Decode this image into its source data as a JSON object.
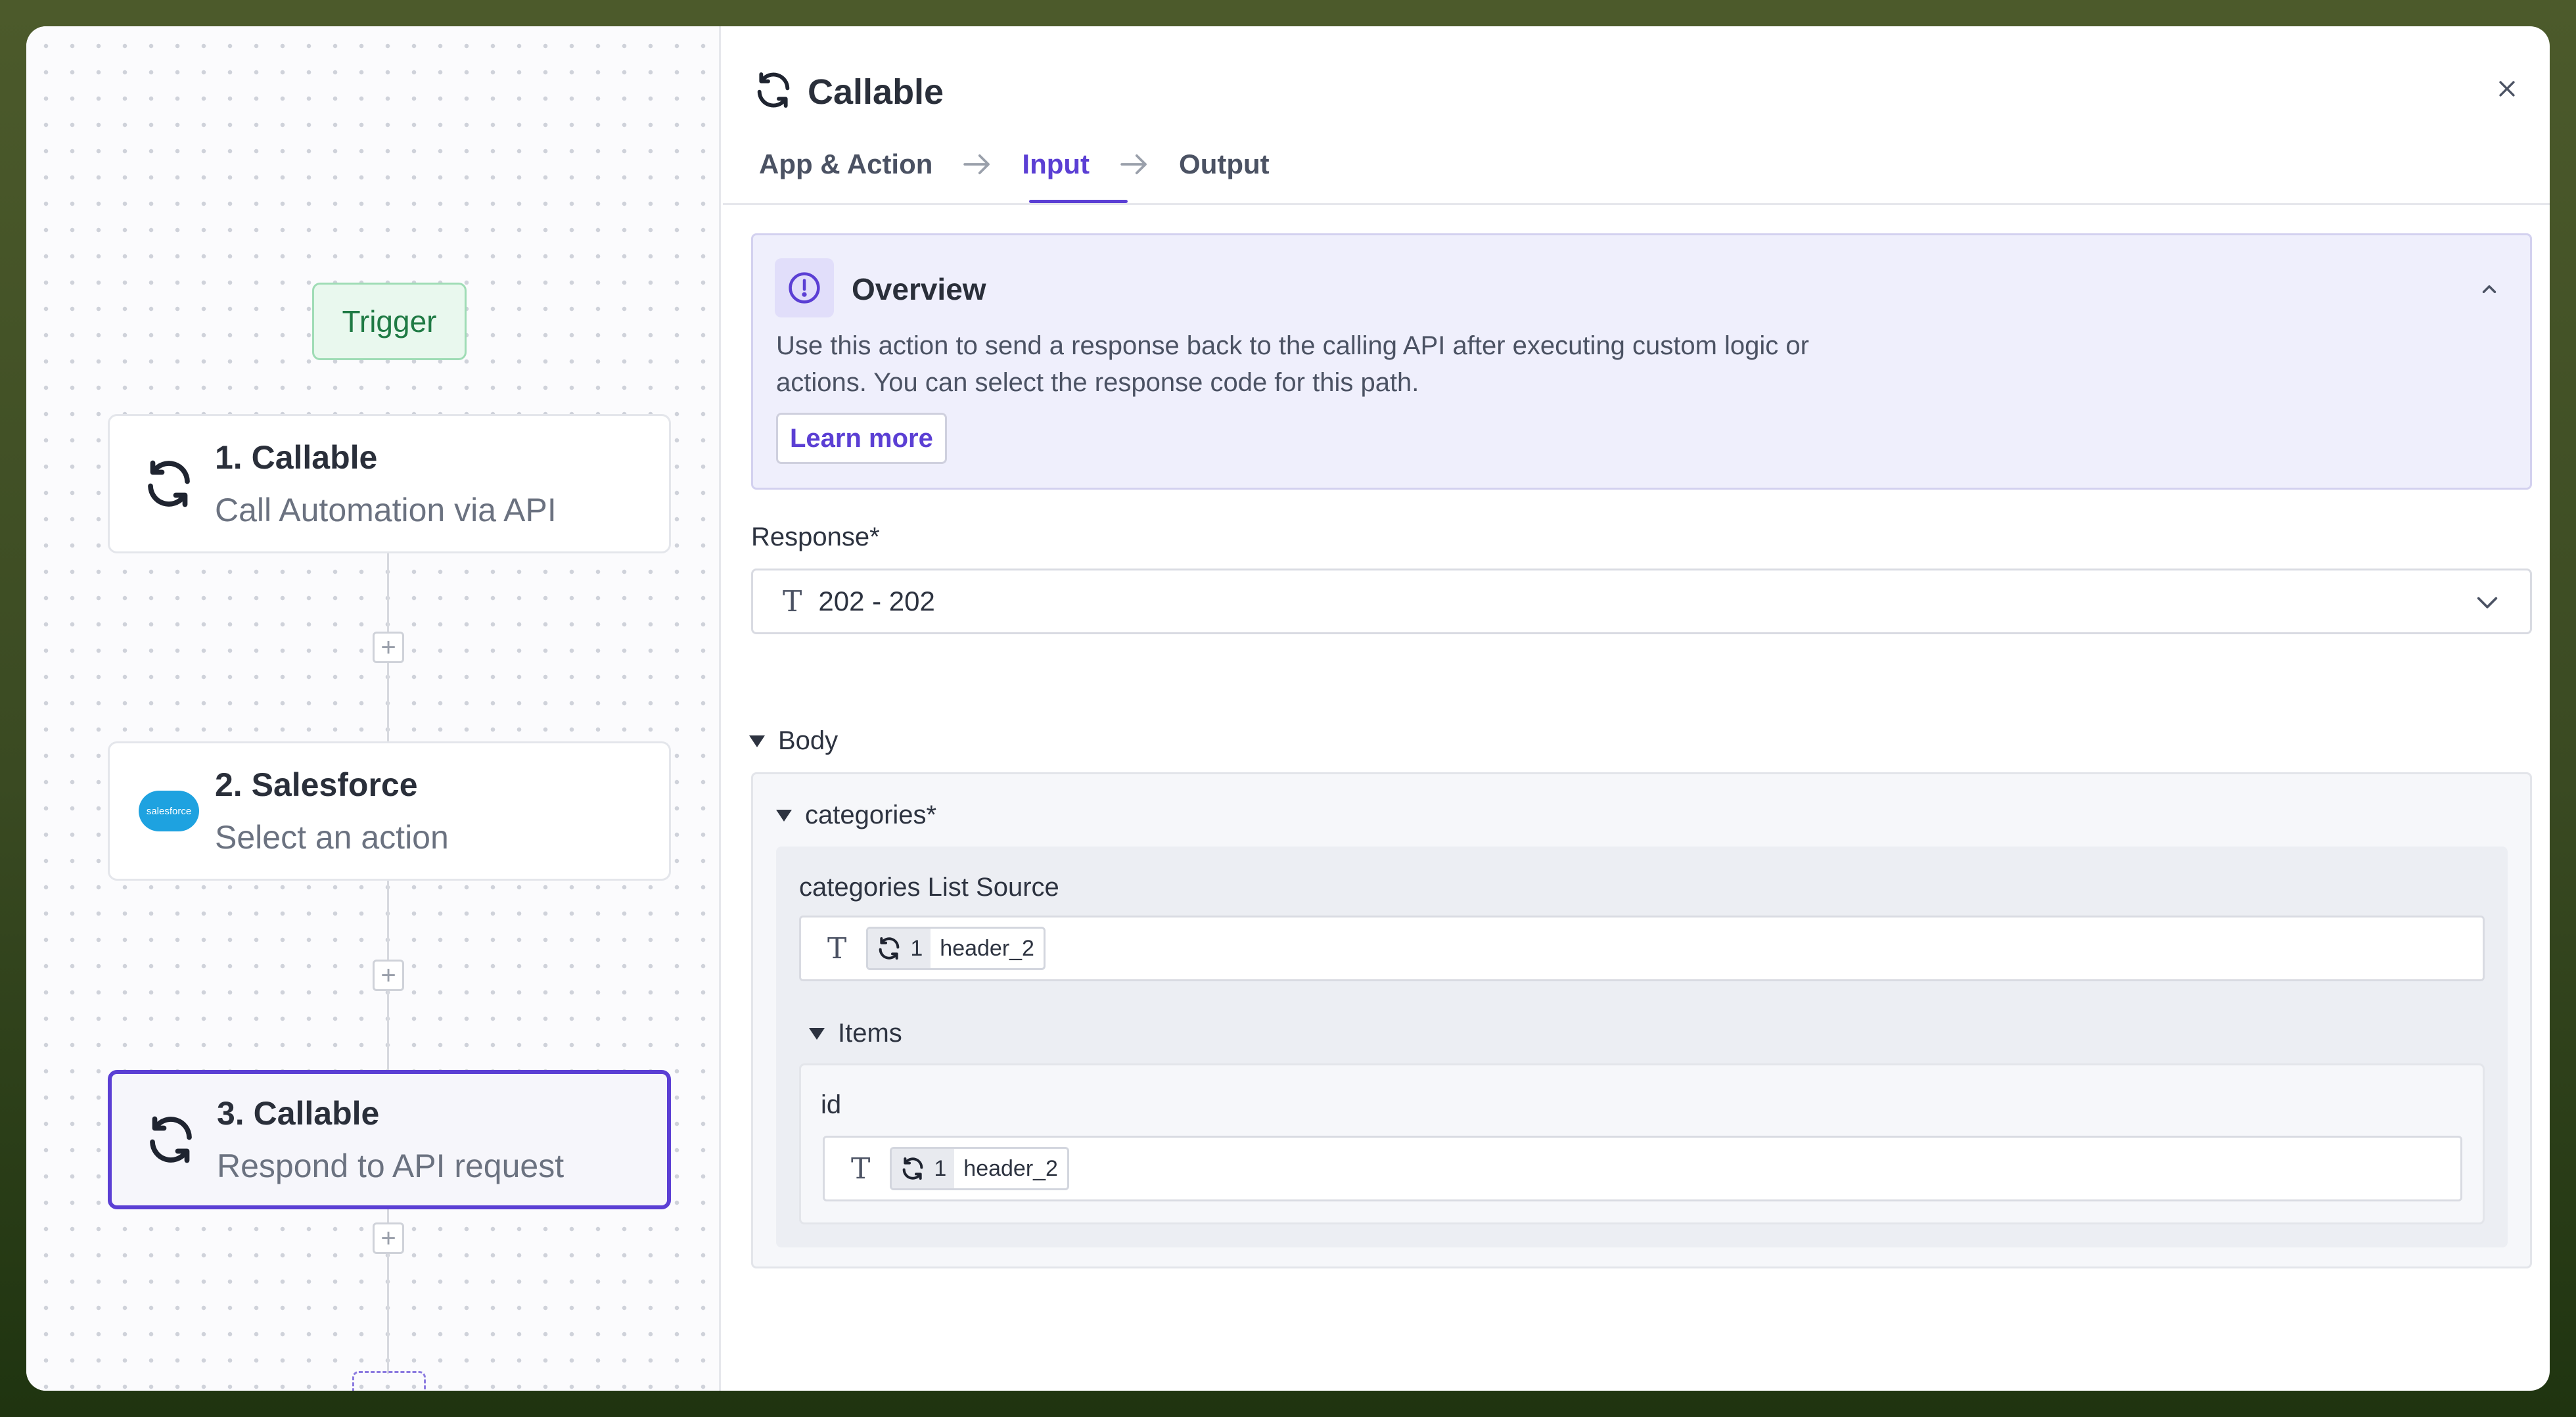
{
  "canvas": {
    "trigger_label": "Trigger",
    "nodes": [
      {
        "title": "1. Callable",
        "subtitle": "Call Automation via API",
        "icon": "callable-sync-icon"
      },
      {
        "title": "2. Salesforce",
        "subtitle": "Select an action",
        "icon": "salesforce-logo",
        "logo_text": "salesforce"
      },
      {
        "title": "3. Callable",
        "subtitle": "Respond to API request",
        "icon": "callable-sync-icon",
        "selected": true
      }
    ],
    "add_step_symbol": "+"
  },
  "panel": {
    "title": "Callable",
    "tabs": [
      {
        "label": "App & Action",
        "active": false
      },
      {
        "label": "Input",
        "active": true
      },
      {
        "label": "Output",
        "active": false
      }
    ],
    "overview": {
      "title": "Overview",
      "description": "Use this action to send a response back to the calling API after executing custom logic or actions. You can select the response code for this path.",
      "learn_more_label": "Learn more"
    },
    "response": {
      "label": "Response*",
      "type_glyph": "T",
      "value": "202 - 202"
    },
    "body": {
      "label": "Body",
      "categories": {
        "label": "categories*",
        "list_source_label": "categories List Source",
        "list_source_token": {
          "step": "1",
          "field": "header_2"
        },
        "items_label": "Items",
        "id_label": "id",
        "id_token": {
          "step": "1",
          "field": "header_2"
        }
      }
    }
  },
  "colors": {
    "accent": "#5b3fd4",
    "trigger_bg": "#e9f8ee",
    "overview_bg": "#efeffc",
    "salesforce_blue": "#1ea2e0"
  }
}
